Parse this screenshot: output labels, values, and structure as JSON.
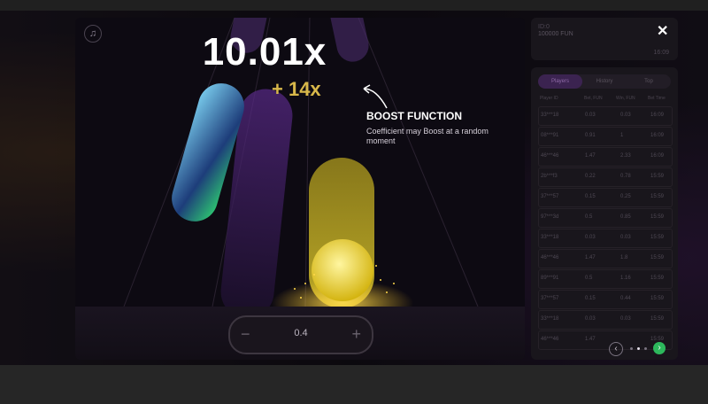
{
  "game": {
    "multiplier": "10.01x",
    "boost_amount": "+ 14x",
    "boost_title": "BOOST FUNCTION",
    "boost_description": "Coefficient may Boost at a random moment",
    "music_icon": "music-note-icon",
    "bet": {
      "minus": "−",
      "value": "0.4",
      "plus": "+"
    }
  },
  "panel": {
    "balance_label": "ID:0",
    "balance": "100000 FUN",
    "time": "16:09",
    "close": "✕",
    "tabs": [
      {
        "label": "Players",
        "active": true
      },
      {
        "label": "History",
        "active": false
      },
      {
        "label": "Top",
        "active": false
      }
    ],
    "columns": [
      "Player ID",
      "Bet, FUN",
      "Win, FUN",
      "Bet Time"
    ],
    "rows": [
      [
        "33***18",
        "0.03",
        "0.03",
        "16:09"
      ],
      [
        "08***91",
        "0.91",
        "1",
        "16:09"
      ],
      [
        "46***46",
        "1.47",
        "2.33",
        "16:09"
      ],
      [
        "2b***f3",
        "0.22",
        "0.78",
        "15:59"
      ],
      [
        "37***57",
        "0.15",
        "0.25",
        "15:59"
      ],
      [
        "97***3d",
        "0.5",
        "0.85",
        "15:59"
      ],
      [
        "33***18",
        "0.03",
        "0.03",
        "15:59"
      ],
      [
        "46***46",
        "1.47",
        "1.8",
        "15:59"
      ],
      [
        "89***91",
        "0.5",
        "1.16",
        "15:59"
      ],
      [
        "37***57",
        "0.15",
        "0.44",
        "15:59"
      ],
      [
        "33***18",
        "0.03",
        "0.03",
        "15:59"
      ],
      [
        "46***46",
        "1.47",
        "",
        "15:59"
      ]
    ],
    "pager": {
      "prev": "‹",
      "next": "›"
    }
  },
  "colors": {
    "accent": "#2db85c",
    "gold": "#d8b84a",
    "tab_active": "#3b2350"
  }
}
